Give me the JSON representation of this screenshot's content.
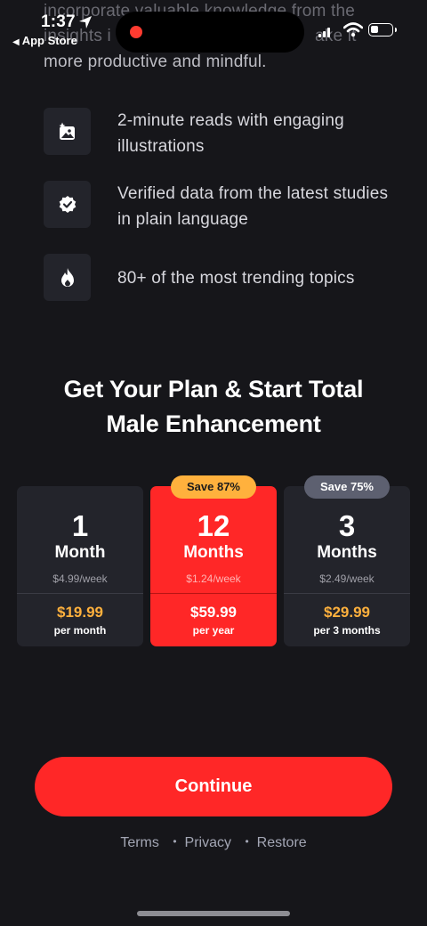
{
  "status_bar": {
    "time": "1:37",
    "back_app": "App Store"
  },
  "intro": {
    "line1": "incorporate valuable knowledge from the",
    "line2_prefix": "insights i",
    "line2_suffix": "ake it",
    "line3": "more productive and mindful."
  },
  "features": [
    {
      "icon": "image-sparkle-icon",
      "text": "2-minute reads with engaging illustrations"
    },
    {
      "icon": "verified-badge-icon",
      "text": "Verified data from the latest studies in plain language"
    },
    {
      "icon": "fire-icon",
      "text": "80+ of the most trending topics"
    }
  ],
  "plans_title": "Get Your Plan & Start Total Male Enhancement",
  "plans": [
    {
      "number": "1",
      "unit": "Month",
      "weekly": "$4.99/week",
      "price": "$19.99",
      "period": "per month",
      "badge": "",
      "selected": false
    },
    {
      "number": "12",
      "unit": "Months",
      "weekly": "$1.24/week",
      "price": "$59.99",
      "period": "per year",
      "badge": "Save 87%",
      "selected": true
    },
    {
      "number": "3",
      "unit": "Months",
      "weekly": "$2.49/week",
      "price": "$29.99",
      "period": "per 3 months",
      "badge": "Save 75%",
      "selected": false
    }
  ],
  "continue_label": "Continue",
  "links": {
    "terms": "Terms",
    "privacy": "Privacy",
    "restore": "Restore",
    "separator": "•"
  },
  "colors": {
    "background": "#16161a",
    "accent_red": "#ff2727",
    "accent_orange": "#ffb13d",
    "card": "#23242b"
  }
}
